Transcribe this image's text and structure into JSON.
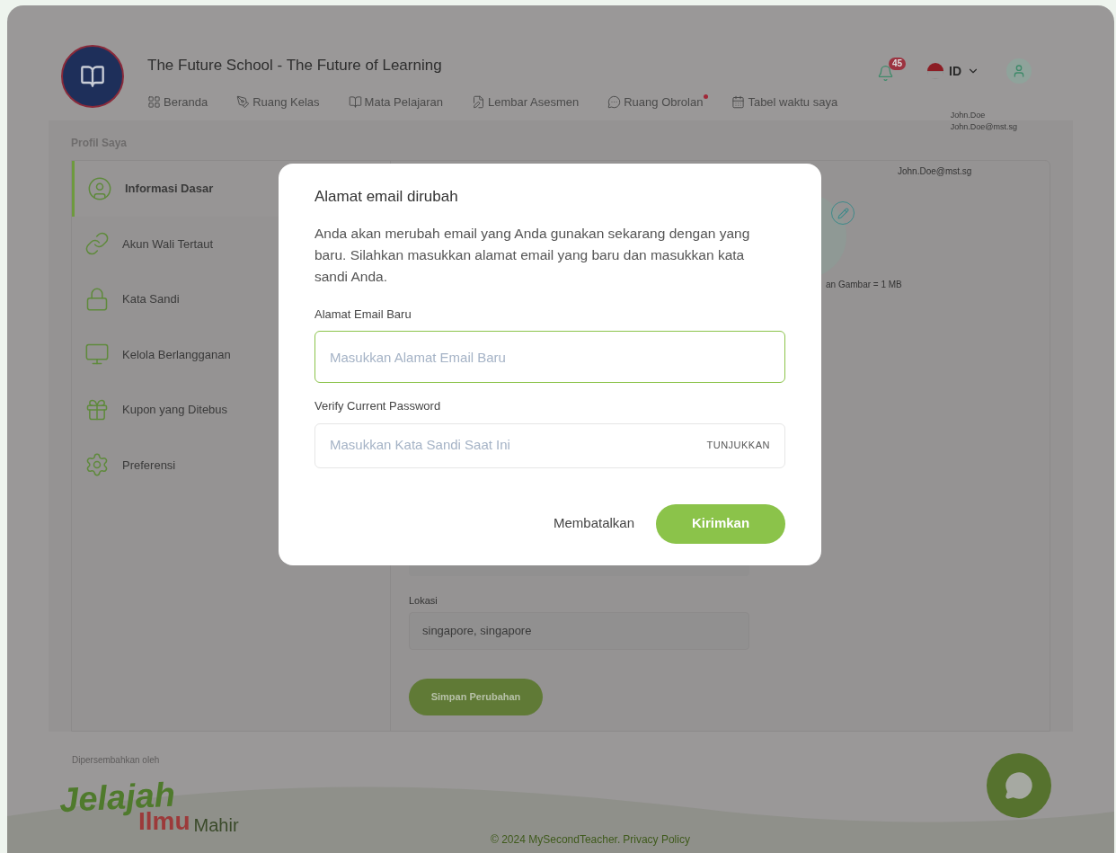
{
  "header": {
    "title": "The Future School - The Future of Learning",
    "notification_count": "45",
    "language": "ID",
    "user_name": "John.Doe",
    "user_email": "John.Doe@mst.sg",
    "nav": [
      {
        "label": "Beranda",
        "dot": false
      },
      {
        "label": "Ruang Kelas",
        "dot": false
      },
      {
        "label": "Mata Pelajaran",
        "dot": false
      },
      {
        "label": "Lembar Asesmen",
        "dot": false
      },
      {
        "label": "Ruang Obrolan",
        "dot": true
      },
      {
        "label": "Tabel waktu saya",
        "dot": false
      }
    ]
  },
  "page_title": "Profil Saya",
  "sidebar": [
    {
      "label": "Informasi Dasar",
      "selected": true
    },
    {
      "label": "Akun Wali Tertaut",
      "selected": false
    },
    {
      "label": "Kata Sandi",
      "selected": false
    },
    {
      "label": "Kelola Berlangganan",
      "selected": false
    },
    {
      "label": "Kupon yang Ditebus",
      "selected": false
    },
    {
      "label": "Preferensi",
      "selected": false
    }
  ],
  "profile": {
    "email": "John.Doe@mst.sg",
    "image_note": "an Gambar = 1 MB",
    "location_label": "Lokasi",
    "location_value": "singapore, singapore",
    "save_button": "Simpan Perubahan"
  },
  "dialog": {
    "title": "Alamat email dirubah",
    "message": "Anda akan merubah email yang Anda gunakan sekarang dengan yang baru. Silahkan masukkan alamat email yang baru dan masukkan kata sandi Anda.",
    "email_label": "Alamat Email Baru",
    "email_placeholder": "Masukkan Alamat Email Baru",
    "password_label": "Verify Current Password",
    "password_placeholder": "Masukkan Kata Sandi Saat Ini",
    "show_button": "TUNJUKKAN",
    "cancel": "Membatalkan",
    "submit": "Kirimkan"
  },
  "footer": {
    "presented_by": "Dipersembahkan oleh",
    "logo_top": "Jelajah",
    "logo_middle": "Ilmu",
    "logo_end": "Mahir",
    "copyright": "© 2024 MySecondTeacher.",
    "privacy": "Privacy Policy"
  }
}
